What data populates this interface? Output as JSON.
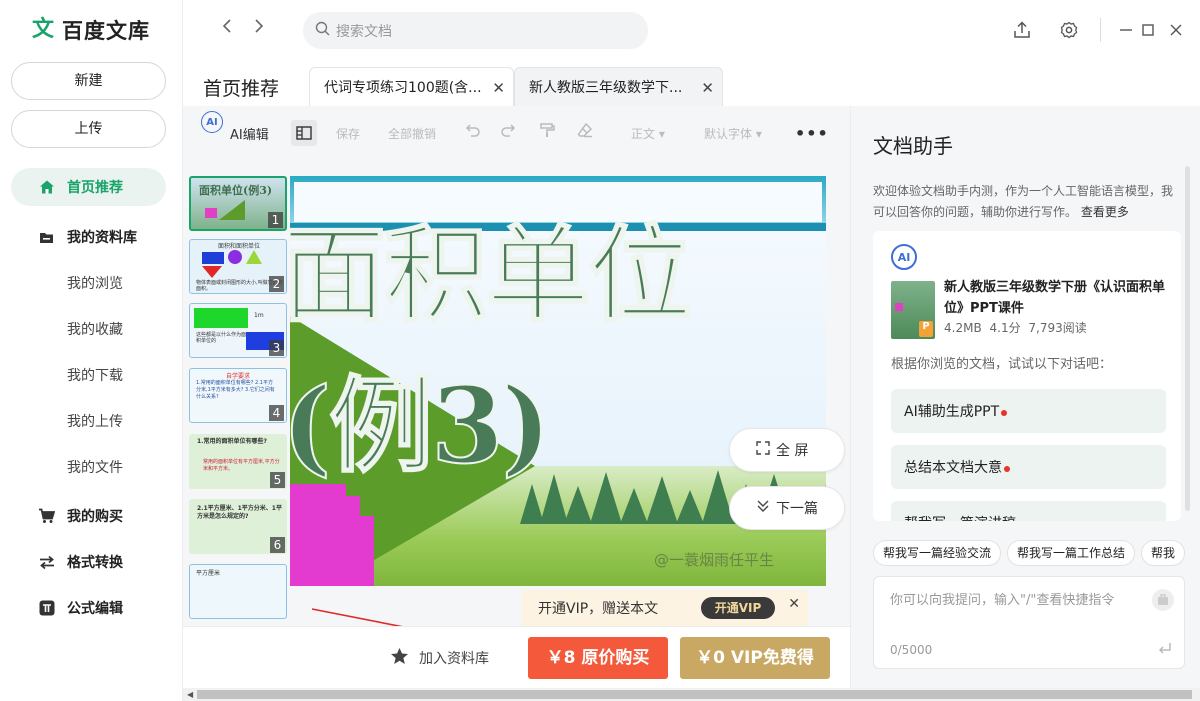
{
  "app": {
    "logo_mark": "文",
    "logo_text": "百度文库"
  },
  "sidebar": {
    "new_label": "新建",
    "upload_label": "上传",
    "nav": [
      {
        "label": "首页推荐",
        "icon": "home-icon",
        "active": true
      },
      {
        "label": "我的资料库",
        "icon": "folder-icon",
        "active": false
      },
      {
        "label": "我的购买",
        "icon": "cart-icon",
        "active": false
      },
      {
        "label": "格式转换",
        "icon": "swap-icon",
        "active": false
      },
      {
        "label": "公式编辑",
        "icon": "pi-icon",
        "active": false
      }
    ],
    "library_sub": [
      "我的浏览",
      "我的收藏",
      "我的下载",
      "我的上传",
      "我的文件"
    ]
  },
  "topbar": {
    "search_placeholder": "搜索文档"
  },
  "tabs": {
    "home": "首页推荐",
    "docs": [
      {
        "label": "代词专项练习100题(含...",
        "active": false
      },
      {
        "label": "新人教版三年级数学下...",
        "active": true
      }
    ]
  },
  "toolbar": {
    "ai_edit": "AI编辑",
    "save": "保存",
    "undo_all": "全部撤销",
    "style": "正文",
    "font": "默认字体"
  },
  "slide": {
    "title_text": "面积单位(例3)",
    "watermark": "@一蓑烟雨任平生",
    "thumb_numbers": [
      "1",
      "2",
      "3",
      "4",
      "5",
      "6"
    ],
    "thumb_texts": {
      "t1": "面积单位(例3)",
      "t2": "面积和面积单位",
      "t2b": "物体表面或封闭图形的大小,叫做它们的面积。",
      "t3": "1m",
      "t3b": "这些都是以什么作为面积单位的",
      "t4": "自学要求",
      "t4b": "1.常用的面积单位有哪些? 2.1平方分米,1平方米有多大? 3.它们之间有什么关系?",
      "t5": "1.常用的面积单位有哪些?",
      "t5b": "常用的面积单位有平方厘米,平方分米和平方米。",
      "t6": "2.1平方厘米、1平方分米、1平方米是怎么规定的?",
      "t7": "平方厘米"
    }
  },
  "float_buttons": {
    "fullscreen": "全 屏",
    "next": "下一篇"
  },
  "vip_tip": {
    "text": "开通VIP，赠送本文",
    "button": "开通VIP"
  },
  "bottom": {
    "add_library": "加入资料库",
    "buy": "￥8 原价购买",
    "vip_free": "￥0 VIP免费得"
  },
  "assistant": {
    "title": "文档助手",
    "desc": "欢迎体验文档助手内测，作为一个人工智能语言模型，我可以回答你的问题，辅助你进行写作。",
    "more": "查看更多",
    "doc_title": "新人教版三年级数学下册《认识面积单位》PPT课件",
    "doc_size": "4.2MB",
    "doc_score": "4.1分",
    "doc_reads": "7,793阅读",
    "hint": "根据你浏览的文档，试试以下对话吧：",
    "suggestions": [
      "AI辅助生成PPT",
      "总结本文档大意",
      "帮我写一篇演讲稿"
    ],
    "chips": [
      "帮我写一篇经验交流",
      "帮我写一篇工作总结",
      "帮我"
    ],
    "input_placeholder": "你可以向我提问，输入\"/\"查看快捷指令",
    "char_count": "0/5000"
  },
  "colors": {
    "brand_green": "#1aa36a",
    "buy_red": "#f3593a",
    "vip_gold": "#c9a863"
  }
}
